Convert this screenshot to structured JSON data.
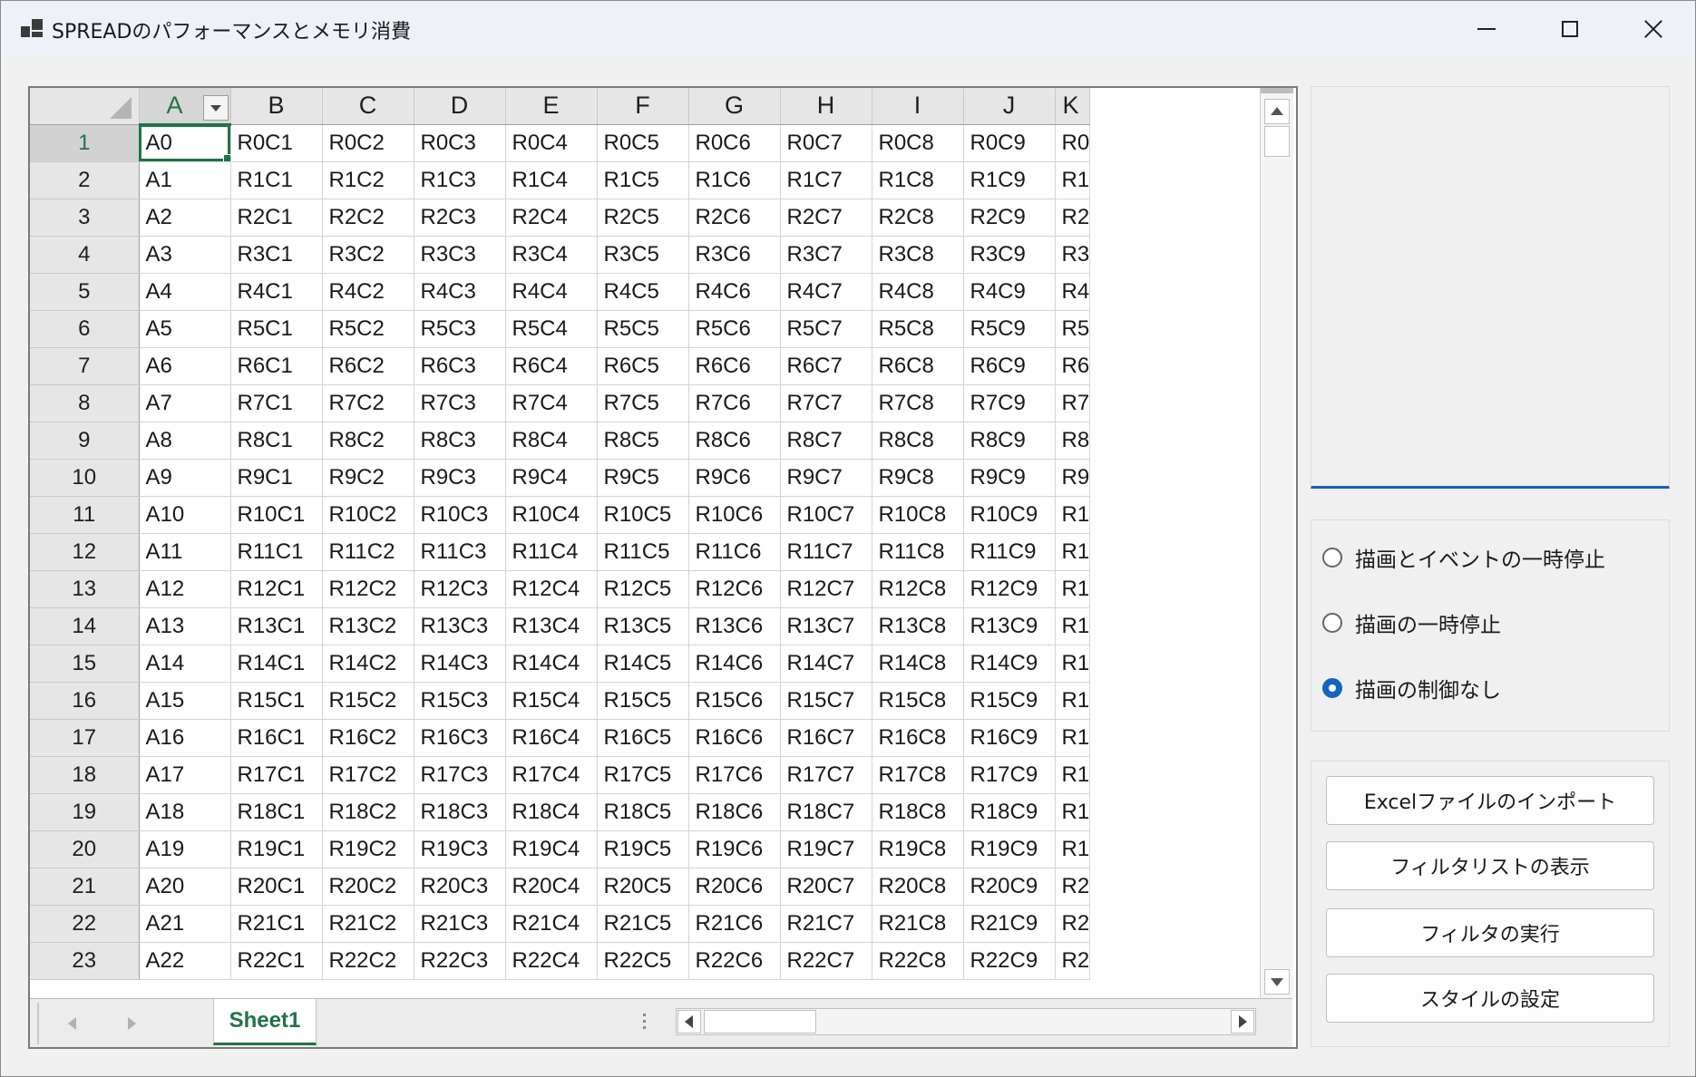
{
  "window": {
    "title": "SPREADのパフォーマンスとメモリ消費",
    "icon": "app-window-icon"
  },
  "spread": {
    "columns": [
      "A",
      "B",
      "C",
      "D",
      "E",
      "F",
      "G",
      "H",
      "I",
      "J"
    ],
    "partial_column": "K",
    "active_column": "A",
    "active_row": 1,
    "rows": [
      {
        "n": "1",
        "cells": [
          "A0",
          "R0C1",
          "R0C2",
          "R0C3",
          "R0C4",
          "R0C5",
          "R0C6",
          "R0C7",
          "R0C8",
          "R0C9"
        ],
        "partial": "R0"
      },
      {
        "n": "2",
        "cells": [
          "A1",
          "R1C1",
          "R1C2",
          "R1C3",
          "R1C4",
          "R1C5",
          "R1C6",
          "R1C7",
          "R1C8",
          "R1C9"
        ],
        "partial": "R1"
      },
      {
        "n": "3",
        "cells": [
          "A2",
          "R2C1",
          "R2C2",
          "R2C3",
          "R2C4",
          "R2C5",
          "R2C6",
          "R2C7",
          "R2C8",
          "R2C9"
        ],
        "partial": "R2"
      },
      {
        "n": "4",
        "cells": [
          "A3",
          "R3C1",
          "R3C2",
          "R3C3",
          "R3C4",
          "R3C5",
          "R3C6",
          "R3C7",
          "R3C8",
          "R3C9"
        ],
        "partial": "R3"
      },
      {
        "n": "5",
        "cells": [
          "A4",
          "R4C1",
          "R4C2",
          "R4C3",
          "R4C4",
          "R4C5",
          "R4C6",
          "R4C7",
          "R4C8",
          "R4C9"
        ],
        "partial": "R4"
      },
      {
        "n": "6",
        "cells": [
          "A5",
          "R5C1",
          "R5C2",
          "R5C3",
          "R5C4",
          "R5C5",
          "R5C6",
          "R5C7",
          "R5C8",
          "R5C9"
        ],
        "partial": "R5"
      },
      {
        "n": "7",
        "cells": [
          "A6",
          "R6C1",
          "R6C2",
          "R6C3",
          "R6C4",
          "R6C5",
          "R6C6",
          "R6C7",
          "R6C8",
          "R6C9"
        ],
        "partial": "R6"
      },
      {
        "n": "8",
        "cells": [
          "A7",
          "R7C1",
          "R7C2",
          "R7C3",
          "R7C4",
          "R7C5",
          "R7C6",
          "R7C7",
          "R7C8",
          "R7C9"
        ],
        "partial": "R7"
      },
      {
        "n": "9",
        "cells": [
          "A8",
          "R8C1",
          "R8C2",
          "R8C3",
          "R8C4",
          "R8C5",
          "R8C6",
          "R8C7",
          "R8C8",
          "R8C9"
        ],
        "partial": "R8"
      },
      {
        "n": "10",
        "cells": [
          "A9",
          "R9C1",
          "R9C2",
          "R9C3",
          "R9C4",
          "R9C5",
          "R9C6",
          "R9C7",
          "R9C8",
          "R9C9"
        ],
        "partial": "R9"
      },
      {
        "n": "11",
        "cells": [
          "A10",
          "R10C1",
          "R10C2",
          "R10C3",
          "R10C4",
          "R10C5",
          "R10C6",
          "R10C7",
          "R10C8",
          "R10C9"
        ],
        "partial": "R1"
      },
      {
        "n": "12",
        "cells": [
          "A11",
          "R11C1",
          "R11C2",
          "R11C3",
          "R11C4",
          "R11C5",
          "R11C6",
          "R11C7",
          "R11C8",
          "R11C9"
        ],
        "partial": "R1"
      },
      {
        "n": "13",
        "cells": [
          "A12",
          "R12C1",
          "R12C2",
          "R12C3",
          "R12C4",
          "R12C5",
          "R12C6",
          "R12C7",
          "R12C8",
          "R12C9"
        ],
        "partial": "R1"
      },
      {
        "n": "14",
        "cells": [
          "A13",
          "R13C1",
          "R13C2",
          "R13C3",
          "R13C4",
          "R13C5",
          "R13C6",
          "R13C7",
          "R13C8",
          "R13C9"
        ],
        "partial": "R1"
      },
      {
        "n": "15",
        "cells": [
          "A14",
          "R14C1",
          "R14C2",
          "R14C3",
          "R14C4",
          "R14C5",
          "R14C6",
          "R14C7",
          "R14C8",
          "R14C9"
        ],
        "partial": "R1"
      },
      {
        "n": "16",
        "cells": [
          "A15",
          "R15C1",
          "R15C2",
          "R15C3",
          "R15C4",
          "R15C5",
          "R15C6",
          "R15C7",
          "R15C8",
          "R15C9"
        ],
        "partial": "R1"
      },
      {
        "n": "17",
        "cells": [
          "A16",
          "R16C1",
          "R16C2",
          "R16C3",
          "R16C4",
          "R16C5",
          "R16C6",
          "R16C7",
          "R16C8",
          "R16C9"
        ],
        "partial": "R1"
      },
      {
        "n": "18",
        "cells": [
          "A17",
          "R17C1",
          "R17C2",
          "R17C3",
          "R17C4",
          "R17C5",
          "R17C6",
          "R17C7",
          "R17C8",
          "R17C9"
        ],
        "partial": "R1"
      },
      {
        "n": "19",
        "cells": [
          "A18",
          "R18C1",
          "R18C2",
          "R18C3",
          "R18C4",
          "R18C5",
          "R18C6",
          "R18C7",
          "R18C8",
          "R18C9"
        ],
        "partial": "R1"
      },
      {
        "n": "20",
        "cells": [
          "A19",
          "R19C1",
          "R19C2",
          "R19C3",
          "R19C4",
          "R19C5",
          "R19C6",
          "R19C7",
          "R19C8",
          "R19C9"
        ],
        "partial": "R1"
      },
      {
        "n": "21",
        "cells": [
          "A20",
          "R20C1",
          "R20C2",
          "R20C3",
          "R20C4",
          "R20C5",
          "R20C6",
          "R20C7",
          "R20C8",
          "R20C9"
        ],
        "partial": "R2"
      },
      {
        "n": "22",
        "cells": [
          "A21",
          "R21C1",
          "R21C2",
          "R21C3",
          "R21C4",
          "R21C5",
          "R21C6",
          "R21C7",
          "R21C8",
          "R21C9"
        ],
        "partial": "R2"
      },
      {
        "n": "23",
        "cells": [
          "A22",
          "R22C1",
          "R22C2",
          "R22C3",
          "R22C4",
          "R22C5",
          "R22C6",
          "R22C7",
          "R22C8",
          "R22C9"
        ],
        "partial": "R2"
      }
    ],
    "sheet_tab": "Sheet1"
  },
  "options": {
    "radios": [
      {
        "label": "描画とイベントの一時停止",
        "checked": false
      },
      {
        "label": "描画の一時停止",
        "checked": false
      },
      {
        "label": "描画の制御なし",
        "checked": true
      }
    ]
  },
  "actions": {
    "buttons": [
      "Excelファイルのインポート",
      "フィルタリストの表示",
      "フィルタの実行",
      "スタイルの設定"
    ]
  },
  "colors": {
    "accent_green": "#217346",
    "accent_blue": "#1565c0"
  }
}
